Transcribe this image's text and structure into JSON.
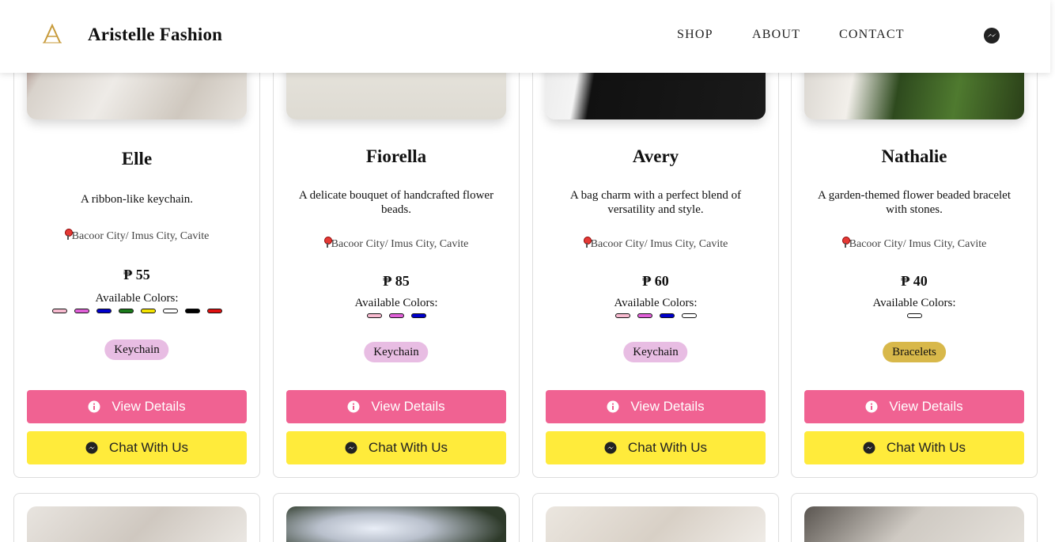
{
  "header": {
    "brand": "Aristelle Fashion",
    "nav": [
      "SHOP",
      "ABOUT",
      "CONTACT"
    ],
    "logo_icon": "logo-a-icon",
    "messenger_icon": "messenger-icon"
  },
  "products": [
    {
      "name": "Elle",
      "description": "A ribbon-like keychain.",
      "location": "Bacoor City/ Imus City, Cavite",
      "price": "₱ 55",
      "colors_label": "Available Colors:",
      "colors": [
        "#f8bbd0",
        "#e060d8",
        "#0000cc",
        "#1b7a1b",
        "#f5e400",
        "#ffffff",
        "#000000",
        "#e01010"
      ],
      "tag": "Keychain",
      "tag_color": "#e8bde3",
      "view_label": "View Details",
      "chat_label": "Chat With Us"
    },
    {
      "name": "Fiorella",
      "description": "A delicate bouquet of handcrafted flower beads.",
      "location": "Bacoor City/ Imus City, Cavite",
      "price": "₱ 85",
      "colors_label": "Available Colors:",
      "colors": [
        "#f8bbd0",
        "#e060d8",
        "#0000cc"
      ],
      "tag": "Keychain",
      "tag_color": "#e8bde3",
      "view_label": "View Details",
      "chat_label": "Chat With Us"
    },
    {
      "name": "Avery",
      "description": "A bag charm with a perfect blend of versatility and style.",
      "location": "Bacoor City/ Imus City, Cavite",
      "price": "₱ 60",
      "colors_label": "Available Colors:",
      "colors": [
        "#f8bbd0",
        "#e060d8",
        "#0000cc",
        "#ffffff"
      ],
      "tag": "Keychain",
      "tag_color": "#e8bde3",
      "view_label": "View Details",
      "chat_label": "Chat With Us"
    },
    {
      "name": "Nathalie",
      "description": "A garden-themed flower beaded bracelet with stones.",
      "location": "Bacoor City/ Imus City, Cavite",
      "price": "₱ 40",
      "colors_label": "Available Colors:",
      "colors": [
        "#ffffff"
      ],
      "tag": "Bracelets",
      "tag_color": "#d8b84a",
      "view_label": "View Details",
      "chat_label": "Chat With Us"
    }
  ]
}
